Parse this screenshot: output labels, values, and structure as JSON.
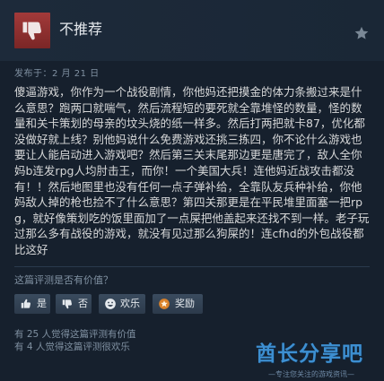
{
  "review": {
    "recommendation": "不推荐",
    "posted": "发布于：2 月 21 日",
    "text": "傻逼游戏，你作为一个战役剧情，你他妈还把摸金的体力条搬过来是什么意思？跑两口就喘气，然后流程短的要死就全靠堆怪的数量，怪的数量和关卡策划的母亲的坟头烧的纸一样多。然后打两把就卡87，优化都没做好就上线？别他妈说什么免费游戏还挑三拣四，你不论什么游戏也要让人能启动进入游戏吧？然后第三关末尾那边更是唐完了，敌人全你妈b连发rpg人均肘击王，而你！一个美国大兵！连他妈近战攻击都没有！！然后地图里也没有任何一点子弹补给，全靠队友兵种补给，你他妈敌人掉的枪也捡不了什么意思？第四关那更是在平民堆里面塞一把rpg，就好像策划吃的饭里面加了一点屎把他盖起来还找不到一样。老子玩过那么多有战役的游戏，就没有见过那么狗屎的！连cfhd的外包战役都比这好"
  },
  "helpful": {
    "question": "这篇评测是否有价值？",
    "yes_label": "是",
    "no_label": "否",
    "funny_label": "欢乐",
    "award_label": "奖励",
    "stat_helpful": "有 25 人觉得这篇评测有价值",
    "stat_funny": "有 4 人觉得这篇评测很欢乐"
  },
  "watermark": {
    "main": "酋长分享吧",
    "sub": "—专注您关注的游戏资讯—"
  },
  "colors": {
    "background": "#1b2838",
    "thumb_down": "#a33a3a",
    "award": "#d9822b",
    "watermark": "#3d8fd1"
  },
  "icons": [
    "thumbs-down-icon",
    "star-icon",
    "thumbs-up-icon",
    "smiley-icon",
    "award-icon"
  ]
}
